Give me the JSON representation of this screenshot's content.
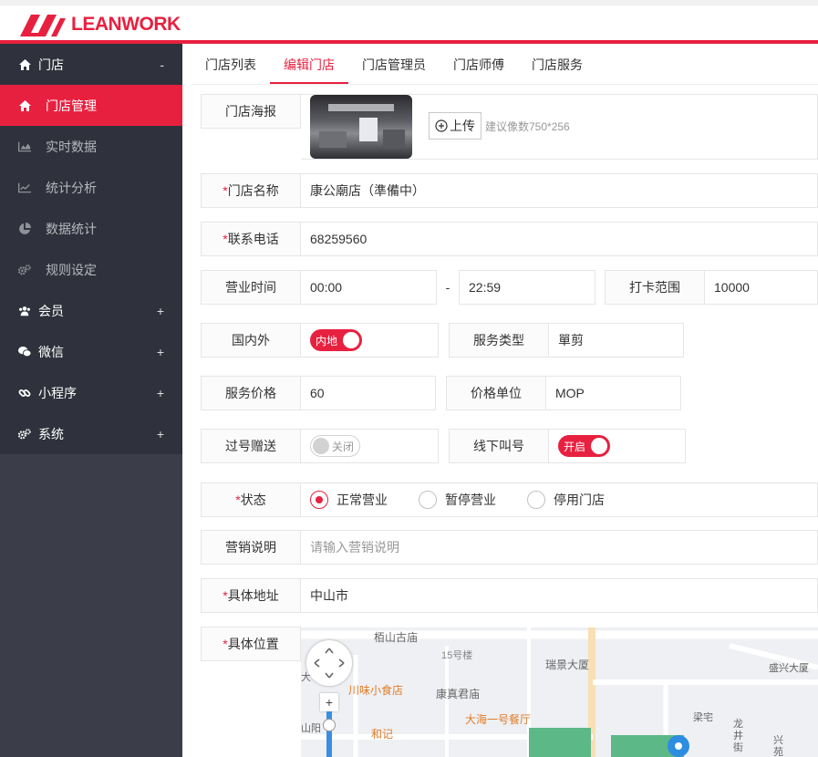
{
  "brand": {
    "name": "LEANWORK",
    "accent": "#e8203f"
  },
  "sidebar": {
    "store": {
      "label": "门店",
      "toggle": "-"
    },
    "store_items": [
      {
        "label": "门店管理",
        "icon": "home-icon",
        "active": true
      },
      {
        "label": "实时数据",
        "icon": "area-chart-icon"
      },
      {
        "label": "统计分析",
        "icon": "line-chart-icon"
      },
      {
        "label": "数据统计",
        "icon": "pie-chart-icon"
      },
      {
        "label": "规则设定",
        "icon": "cogs-icon"
      }
    ],
    "sections": [
      {
        "label": "会员",
        "toggle": "+",
        "icon": "users-icon"
      },
      {
        "label": "微信",
        "toggle": "+",
        "icon": "wechat-icon"
      },
      {
        "label": "小程序",
        "toggle": "+",
        "icon": "link-icon"
      },
      {
        "label": "系统",
        "toggle": "+",
        "icon": "cogs-icon"
      }
    ]
  },
  "tabs": [
    "门店列表",
    "编辑门店",
    "门店管理员",
    "门店师傅",
    "门店服务"
  ],
  "form": {
    "poster": {
      "label": "门店海报",
      "upload": "上传",
      "hint": "建议像数750*256"
    },
    "name": {
      "req": "*",
      "label": "门店名称",
      "value": "康公廟店（準備中）"
    },
    "phone": {
      "req": "*",
      "label": "联系电话",
      "value": "68259560"
    },
    "hours": {
      "label": "营业时间",
      "start": "00:00",
      "sep": "-",
      "end": "22:59"
    },
    "checkin": {
      "label": "打卡范围",
      "value": "10000"
    },
    "region": {
      "label": "国内外",
      "switch": "内地"
    },
    "service_type": {
      "label": "服务类型",
      "value": "單剪"
    },
    "price": {
      "label": "服务价格",
      "value": "60"
    },
    "price_unit": {
      "label": "价格单位",
      "value": "MOP"
    },
    "skip_gift": {
      "label": "过号赠送",
      "switch": "关闭"
    },
    "offline_call": {
      "label": "线下叫号",
      "switch": "开启"
    },
    "status": {
      "req": "*",
      "label": "状态",
      "options": [
        "正常营业",
        "暂停营业",
        "停用门店"
      ],
      "selected": 0
    },
    "marketing": {
      "label": "营销说明",
      "placeholder": "请输入营销说明"
    },
    "address": {
      "req": "*",
      "label": "具体地址",
      "value": "中山市"
    },
    "location": {
      "req": "*",
      "label": "具体位置"
    }
  },
  "map": {
    "labels": [
      "栢山古庙",
      "15号楼",
      "瑞景大厦",
      "盛兴大厦",
      "川味小食店",
      "康真君庙",
      "大海一号餐厅",
      "和记",
      "梁宅",
      "龙井街",
      "山阳",
      "兴苑",
      "大"
    ],
    "controls": {
      "zoom_in": "+"
    }
  }
}
